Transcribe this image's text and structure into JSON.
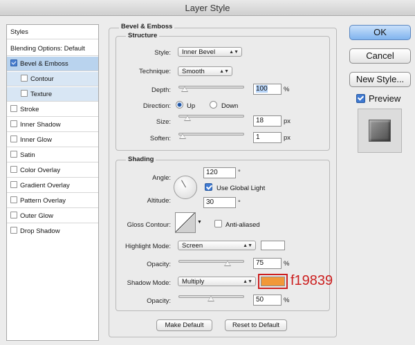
{
  "window": {
    "title": "Layer Style"
  },
  "sidebar": {
    "styles_label": "Styles",
    "blending_label": "Blending Options: Default",
    "items": [
      {
        "label": "Bevel & Emboss",
        "checked": true
      },
      {
        "label": "Contour",
        "checked": false
      },
      {
        "label": "Texture",
        "checked": false
      },
      {
        "label": "Stroke",
        "checked": false
      },
      {
        "label": "Inner Shadow",
        "checked": false
      },
      {
        "label": "Inner Glow",
        "checked": false
      },
      {
        "label": "Satin",
        "checked": false
      },
      {
        "label": "Color Overlay",
        "checked": false
      },
      {
        "label": "Gradient Overlay",
        "checked": false
      },
      {
        "label": "Pattern Overlay",
        "checked": false
      },
      {
        "label": "Outer Glow",
        "checked": false
      },
      {
        "label": "Drop Shadow",
        "checked": false
      }
    ]
  },
  "bevel": {
    "title": "Bevel & Emboss",
    "structure": {
      "title": "Structure",
      "style_label": "Style:",
      "style_value": "Inner Bevel",
      "technique_label": "Technique:",
      "technique_value": "Smooth",
      "depth_label": "Depth:",
      "depth_value": "100",
      "depth_unit": "%",
      "direction_label": "Direction:",
      "direction_up": "Up",
      "direction_down": "Down",
      "size_label": "Size:",
      "size_value": "18",
      "size_unit": "px",
      "soften_label": "Soften:",
      "soften_value": "1",
      "soften_unit": "px"
    },
    "shading": {
      "title": "Shading",
      "angle_label": "Angle:",
      "angle_value": "120",
      "angle_unit": "°",
      "use_global_light": "Use Global Light",
      "altitude_label": "Altitude:",
      "altitude_value": "30",
      "altitude_unit": "°",
      "gloss_label": "Gloss Contour:",
      "anti_aliased": "Anti-aliased",
      "highlight_mode_label": "Highlight Mode:",
      "highlight_mode_value": "Screen",
      "highlight_color": "#ffffff",
      "opacity_label": "Opacity:",
      "highlight_opacity": "75",
      "shadow_mode_label": "Shadow Mode:",
      "shadow_mode_value": "Multiply",
      "shadow_color": "#f19839",
      "shadow_color_annotation": "f19839",
      "shadow_opacity": "50",
      "percent": "%"
    },
    "make_default": "Make Default",
    "reset_default": "Reset to Default"
  },
  "buttons": {
    "ok": "OK",
    "cancel": "Cancel",
    "new_style": "New Style...",
    "preview": "Preview"
  },
  "colors": {
    "accent": "#4a7fd0",
    "annotation": "#cc1f1f",
    "selection": "#b9d3ee"
  }
}
